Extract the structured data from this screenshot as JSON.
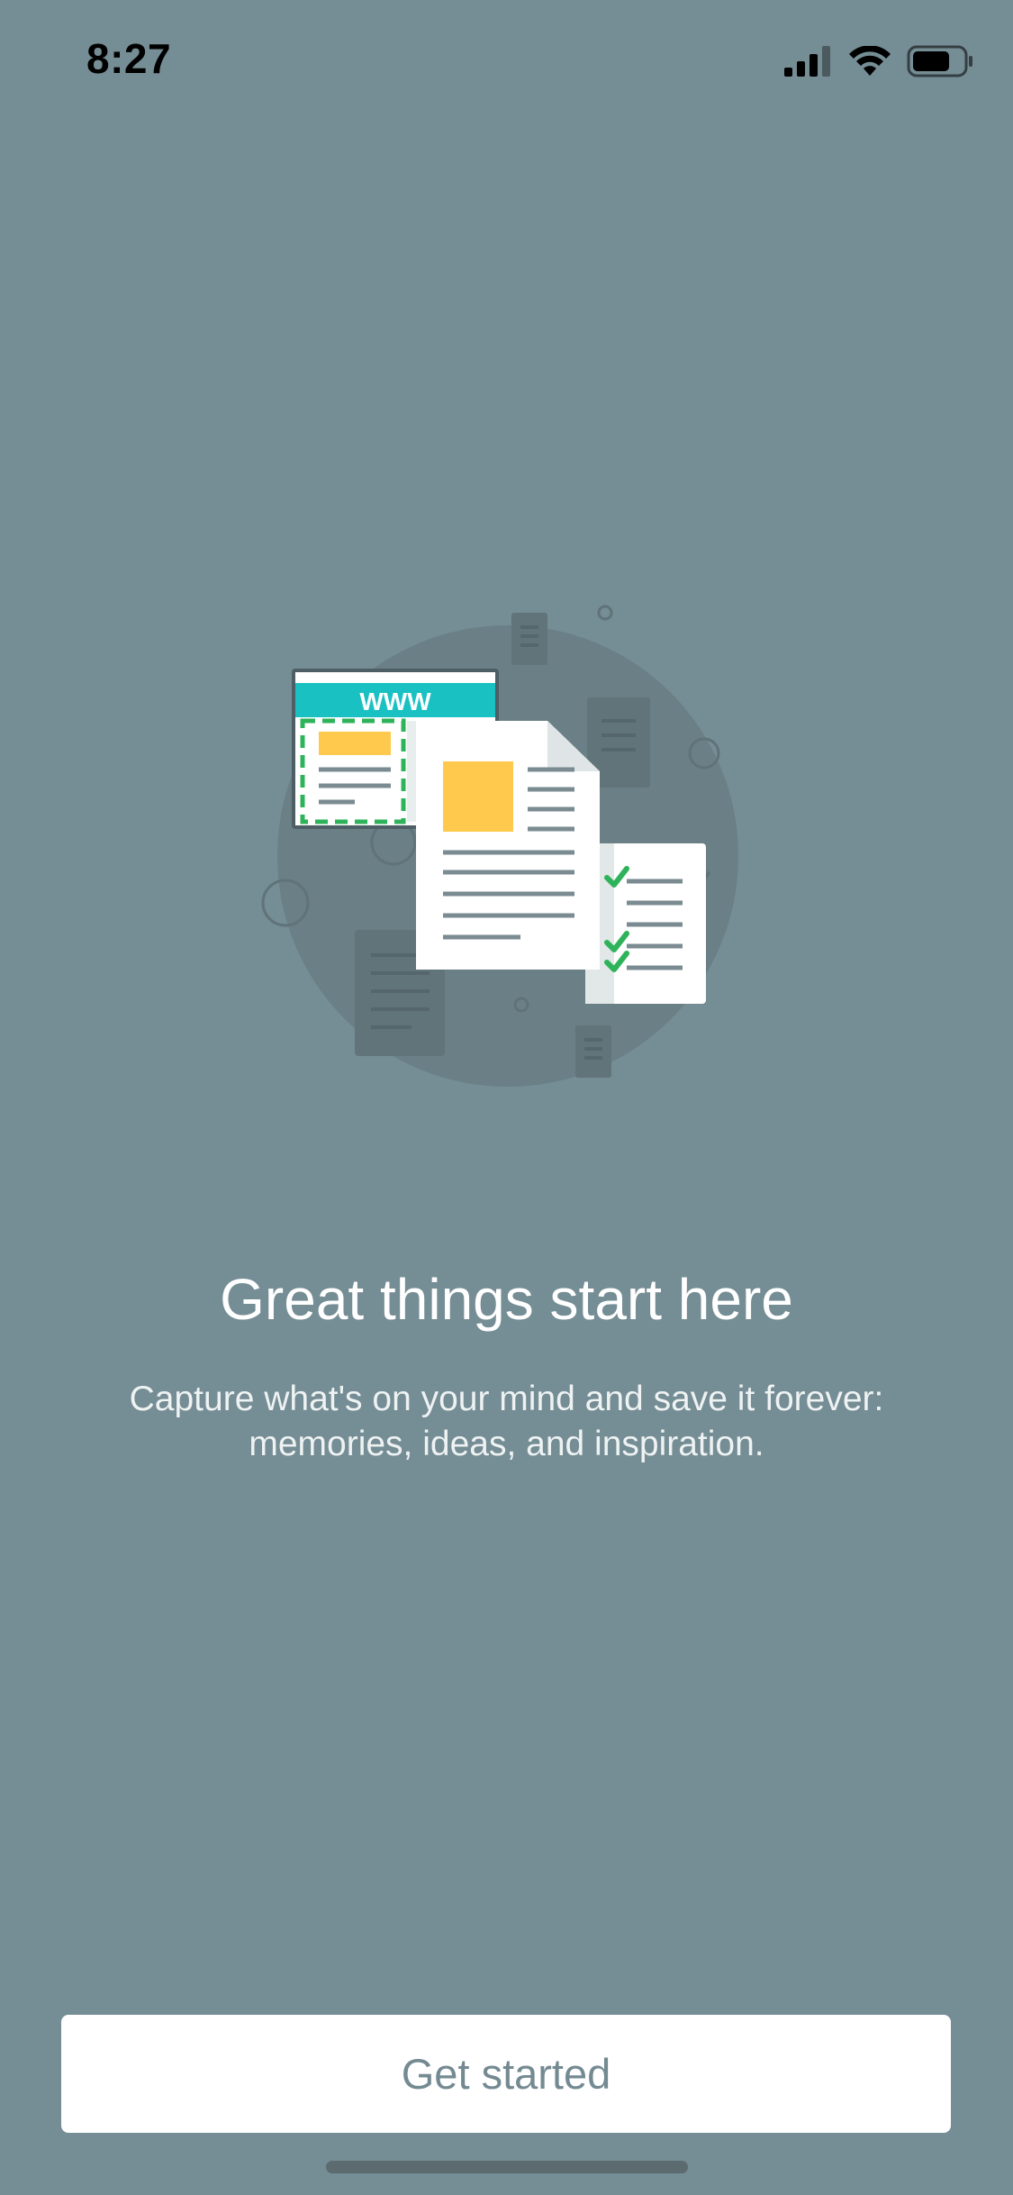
{
  "status_bar": {
    "time": "8:27",
    "icons": [
      "signal-icon",
      "wifi-icon",
      "battery-icon"
    ]
  },
  "illustration": {
    "browser_label": "WWW",
    "colors": {
      "teal": "#19c1c2",
      "yellow": "#ffc94d",
      "green": "#2eb35a",
      "paper": "#ffffff",
      "line": "#7a8b91"
    }
  },
  "onboarding": {
    "title": "Great things start here",
    "subtitle_line1": "Capture what's on your mind and save it forever:",
    "subtitle_line2": "memories, ideas, and inspiration."
  },
  "actions": {
    "get_started_label": "Get started"
  },
  "theme": {
    "background": "#758d94",
    "button_bg": "#ffffff",
    "button_text": "#748a92"
  }
}
